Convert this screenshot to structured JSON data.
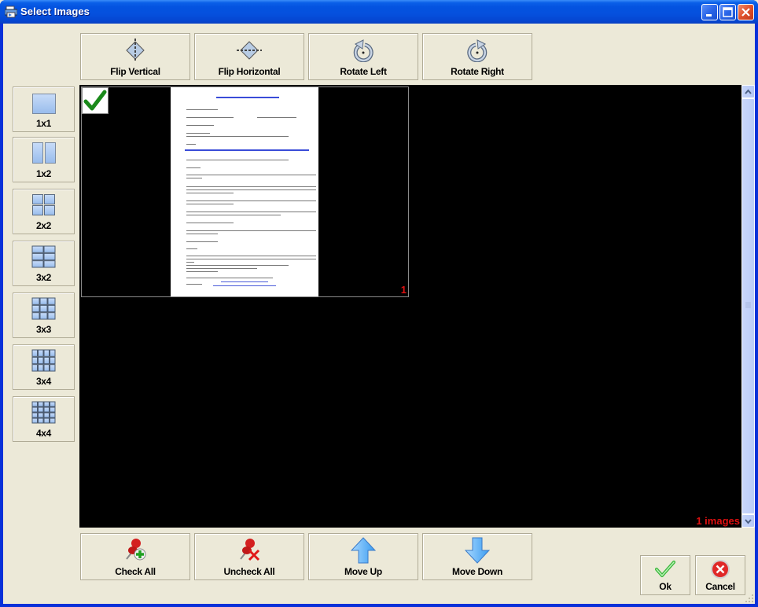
{
  "window": {
    "title": "Select Images",
    "minimize_label": "Minimize",
    "maximize_label": "Maximize",
    "close_label": "Close"
  },
  "toolbar_top": {
    "buttons": [
      {
        "label": "Flip Vertical",
        "icon": "flip-vertical-icon"
      },
      {
        "label": "Flip Horizontal",
        "icon": "flip-horizontal-icon"
      },
      {
        "label": "Rotate Left",
        "icon": "rotate-left-icon"
      },
      {
        "label": "Rotate Right",
        "icon": "rotate-right-icon"
      }
    ]
  },
  "layouts": {
    "buttons": [
      {
        "label": "1x1",
        "icon": "layout-1x1-icon"
      },
      {
        "label": "1x2",
        "icon": "layout-1x2-icon"
      },
      {
        "label": "2x2",
        "icon": "layout-2x2-icon"
      },
      {
        "label": "3x2",
        "icon": "layout-3x2-icon"
      },
      {
        "label": "3x3",
        "icon": "layout-3x3-icon"
      },
      {
        "label": "3x4",
        "icon": "layout-3x4-icon"
      },
      {
        "label": "4x4",
        "icon": "layout-4x4-icon"
      }
    ]
  },
  "viewer": {
    "images": [
      {
        "page_number": "1",
        "checked": true
      }
    ],
    "count_label": "1 images"
  },
  "toolbar_bottom": {
    "buttons": [
      {
        "label": "Check All",
        "icon": "pushpin-add-icon"
      },
      {
        "label": "Uncheck All",
        "icon": "pushpin-remove-icon"
      },
      {
        "label": "Move Up",
        "icon": "arrow-up-icon"
      },
      {
        "label": "Move Down",
        "icon": "arrow-down-icon"
      }
    ]
  },
  "dialog": {
    "ok_label": "Ok",
    "cancel_label": "Cancel"
  },
  "colors": {
    "accent_red": "#e01010",
    "titlebar_blue": "#0453e0",
    "face": "#ece9d8"
  }
}
